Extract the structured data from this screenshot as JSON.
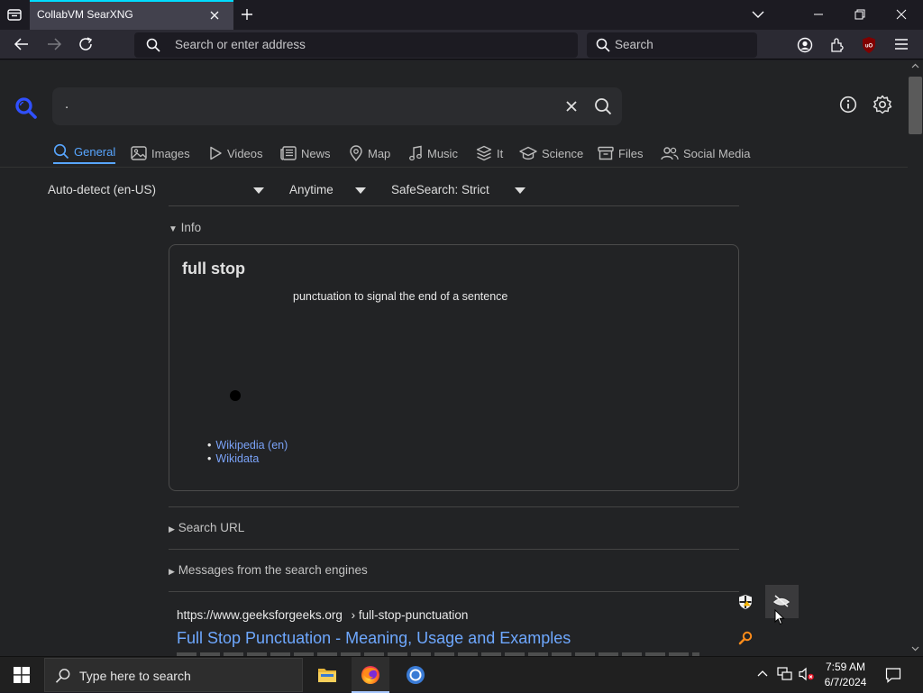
{
  "browser": {
    "tab_title": "CollabVM SearXNG",
    "url_placeholder": "Search or enter address",
    "search_placeholder": "Search"
  },
  "searx": {
    "query": ".",
    "categories": [
      {
        "label": "General",
        "icon": "search-icon",
        "active": true
      },
      {
        "label": "Images",
        "icon": "image-icon"
      },
      {
        "label": "Videos",
        "icon": "play-icon"
      },
      {
        "label": "News",
        "icon": "newspaper-icon"
      },
      {
        "label": "Map",
        "icon": "location-pin-icon"
      },
      {
        "label": "Music",
        "icon": "music-note-icon"
      },
      {
        "label": "It",
        "icon": "layers-icon"
      },
      {
        "label": "Science",
        "icon": "graduation-cap-icon"
      },
      {
        "label": "Files",
        "icon": "archive-icon"
      },
      {
        "label": "Social Media",
        "icon": "people-icon"
      }
    ],
    "filters": {
      "language": "Auto-detect (en-US)",
      "time_range": "Anytime",
      "safesearch": "SafeSearch: Strict"
    },
    "info_summary": "Info",
    "infobox": {
      "title": "full stop",
      "description": "punctuation to signal the end of a sentence",
      "links": [
        "Wikipedia (en)",
        "Wikidata"
      ]
    },
    "search_url_summary": "Search URL",
    "messages_summary": "Messages from the search engines",
    "result": {
      "url": "https://www.geeksforgeeks.org",
      "path": "› full-stop-punctuation",
      "title": "Full Stop Punctuation - Meaning, Usage and Examples"
    }
  },
  "taskbar": {
    "search_placeholder": "Type here to search",
    "time": "7:59 AM",
    "date": "6/7/2024"
  }
}
